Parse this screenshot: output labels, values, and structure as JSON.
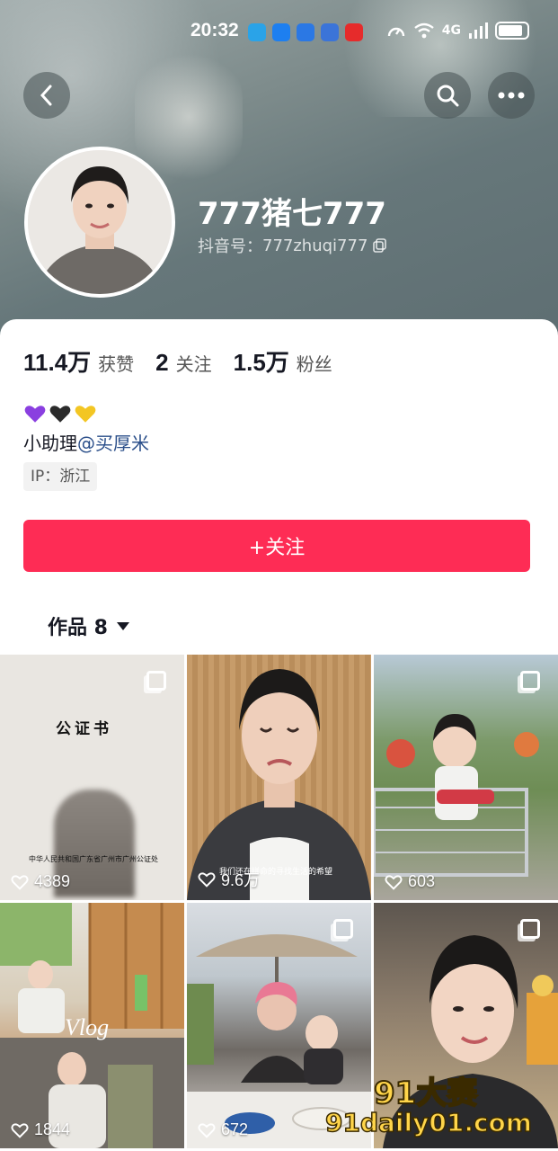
{
  "status_bar": {
    "time": "20:32",
    "network": "4G"
  },
  "header": {
    "username": "777猪七777",
    "douyin_id_label": "抖音号：",
    "douyin_id": "777zhuqi777"
  },
  "stats": [
    {
      "value": "11.4万",
      "label": "获赞"
    },
    {
      "value": "2",
      "label": "关注"
    },
    {
      "value": "1.5万",
      "label": "粉丝"
    }
  ],
  "bio": {
    "hearts": [
      "purple",
      "black",
      "yellow"
    ],
    "prefix": "小助理",
    "mention": "@买厚米",
    "ip": "IP：浙江"
  },
  "follow_button": "+关注",
  "works_tab": {
    "label": "作品 8"
  },
  "videos": [
    {
      "likes": "4389",
      "multi": true,
      "title": "公证书",
      "caption": "中华人民共和国广东省广州市广州公证处"
    },
    {
      "likes": "9.6万",
      "multi": false,
      "caption": "我们还在拼命的寻找生活的希望"
    },
    {
      "likes": "603",
      "multi": true
    },
    {
      "likes": "1844",
      "multi": false,
      "title": "Vlog"
    },
    {
      "likes": "672",
      "multi": true
    },
    {
      "likes": "",
      "multi": true
    }
  ],
  "watermark": {
    "line1": "91大赛",
    "line2": "91daily01.com"
  },
  "colors": {
    "accent": "#fe2c55",
    "mention": "#2b4f8a",
    "header_bg": "#6e7f82"
  }
}
